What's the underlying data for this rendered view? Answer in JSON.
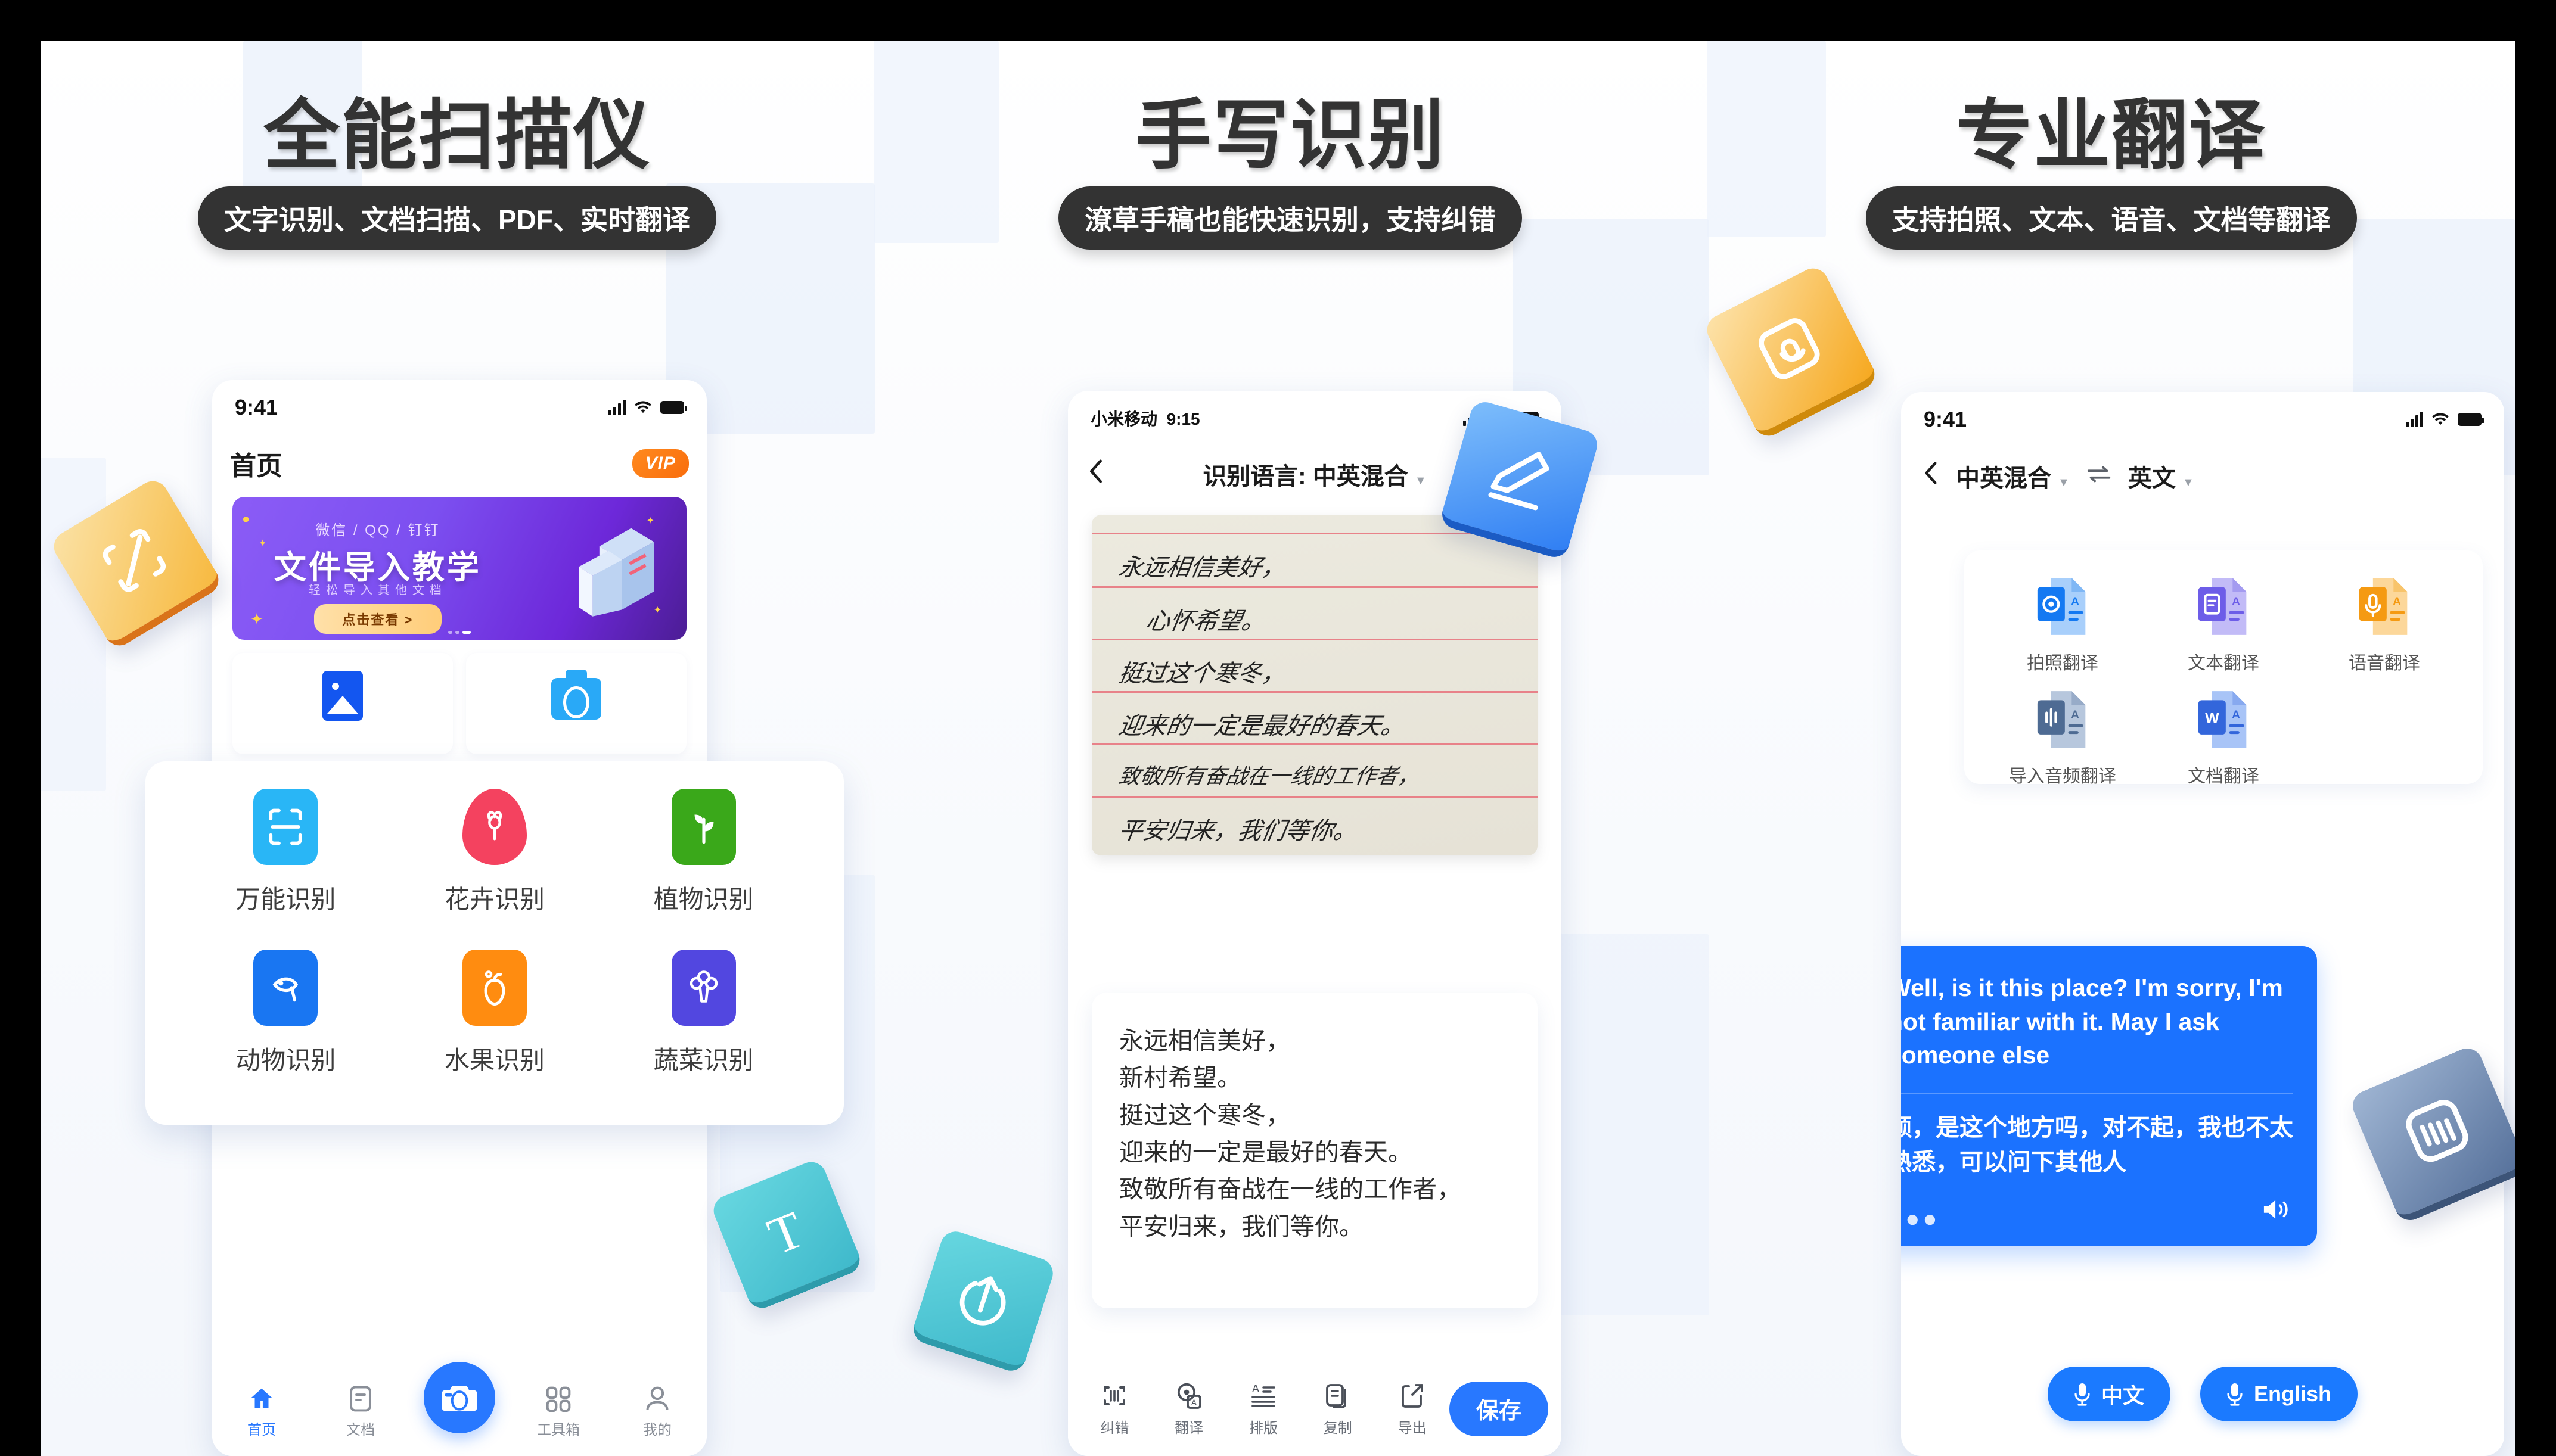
{
  "colors": {
    "brand_blue": "#2878ff",
    "bubble_blue": "#1b72ff",
    "pill_dark": "#333333",
    "vip_orange": "#f96d0c",
    "board_bg": "#ffffff"
  },
  "columns": [
    {
      "headline": "全能扫描仪",
      "subtitle": "文字识别、文档扫描、PDF、实时翻译"
    },
    {
      "headline": "手写识别",
      "subtitle": "潦草手稿也能快速识别，支持纠错"
    },
    {
      "headline": "专业翻译",
      "subtitle": "支持拍照、文本、语音、文档等翻译"
    }
  ],
  "phone1": {
    "status": {
      "time": "9:41",
      "carrier": ""
    },
    "nav_title": "首页",
    "vip_badge": "VIP",
    "banner": {
      "apps": "微信 / QQ / 钉钉",
      "title": "文件导入教学",
      "note": "轻松导入其他文档",
      "button": "点击查看 >"
    },
    "quick_cards": [
      {
        "icon": "image-icon",
        "label": ""
      },
      {
        "icon": "camera-icon",
        "label": ""
      }
    ],
    "recognize_grid": [
      {
        "label": "万能识别",
        "color": "#29b6f6",
        "icon": "scan-frame-icon"
      },
      {
        "label": "花卉识别",
        "color": "#f4425f",
        "icon": "flower-pin-icon"
      },
      {
        "label": "植物识别",
        "color": "#3aa81a",
        "icon": "sprout-icon"
      },
      {
        "label": "动物识别",
        "color": "#1976f2",
        "icon": "fish-icon"
      },
      {
        "label": "水果识别",
        "color": "#ff8c10",
        "icon": "apple-icon"
      },
      {
        "label": "蔬菜识别",
        "color": "#5247e0",
        "icon": "broccoli-icon"
      }
    ],
    "tabs": [
      {
        "label": "首页",
        "icon": "home-icon",
        "active": true
      },
      {
        "label": "文档",
        "icon": "document-icon",
        "active": false
      },
      {
        "label": "",
        "icon": "camera-shutter-icon",
        "active": false
      },
      {
        "label": "工具箱",
        "icon": "grid-icon",
        "active": false
      },
      {
        "label": "我的",
        "icon": "person-icon",
        "active": false
      }
    ]
  },
  "phone2": {
    "status": {
      "carrier": "小米移动",
      "time": "9:15"
    },
    "nav_title": "识别语言: 中英混合",
    "back_icon": "chevron-left-icon",
    "dropdown_icon": "caret-down-icon",
    "handwriting_lines": [
      "永远相信美好，",
      "心怀希望。",
      "挺过这个寒冬，",
      "迎来的一定是最好的春天。",
      "致敬所有奋战在一线的工作者，",
      "平安归来，我们等你。"
    ],
    "result_lines": [
      "永远相信美好，",
      "新村希望。",
      "挺过这个寒冬，",
      "迎来的一定是最好的春天。",
      "致敬所有奋战在一线的工作者，",
      "平安归来，我们等你。"
    ],
    "toolbar": [
      {
        "label": "纠错",
        "icon": "correct-scan-icon"
      },
      {
        "label": "翻译",
        "icon": "translate-icon"
      },
      {
        "label": "排版",
        "icon": "layout-icon"
      },
      {
        "label": "复制",
        "icon": "copy-icon"
      },
      {
        "label": "导出",
        "icon": "export-icon"
      }
    ],
    "save_label": "保存"
  },
  "phone3": {
    "status": {
      "time": "9:41"
    },
    "back_icon": "chevron-left-icon",
    "source_lang": "中英混合",
    "swap_icon": "swap-arrows-icon",
    "target_lang": "英文",
    "translate_grid": [
      {
        "label": "拍照翻译",
        "color": "#2d8cf5",
        "icon": "photo-translate-icon"
      },
      {
        "label": "文本翻译",
        "color": "#7b6cf0",
        "icon": "text-translate-icon"
      },
      {
        "label": "语音翻译",
        "color": "#f5a317",
        "icon": "voice-translate-icon"
      },
      {
        "label": "导入音频翻译",
        "color": "#5b7196",
        "icon": "audio-import-translate-icon"
      },
      {
        "label": "文档翻译",
        "color": "#3f6fe0",
        "icon": "doc-translate-icon"
      }
    ],
    "bubble": {
      "english": "Well, is it this place? I'm sorry, I'm not familiar with it. May I ask someone else",
      "chinese": "额，是这个地方吗，对不起，我也不太熟悉，可以问下其他人",
      "more_icon": "ellipsis-icon",
      "speaker_icon": "speaker-icon"
    },
    "voice_buttons": [
      {
        "label": "中文",
        "icon": "microphone-icon"
      },
      {
        "label": "English",
        "icon": "microphone-icon"
      }
    ]
  },
  "decor_tiles": [
    {
      "name": "scan-tile",
      "icon": "scan-frame-icon",
      "color": "#f7c35c"
    },
    {
      "name": "pencil-tile",
      "icon": "pencil-icon",
      "color": "#3f8cf7"
    },
    {
      "name": "text-tile",
      "icon": "text-T-icon",
      "color": "#4fc6d4"
    },
    {
      "name": "share-tile",
      "icon": "share-circle-icon",
      "color": "#4fc6d4"
    },
    {
      "name": "translate-tile",
      "icon": "translate-round-icon",
      "color": "#f7b236"
    },
    {
      "name": "handwriting-tile",
      "icon": "handwriting-lines-icon",
      "color": "#6d87b5"
    }
  ]
}
